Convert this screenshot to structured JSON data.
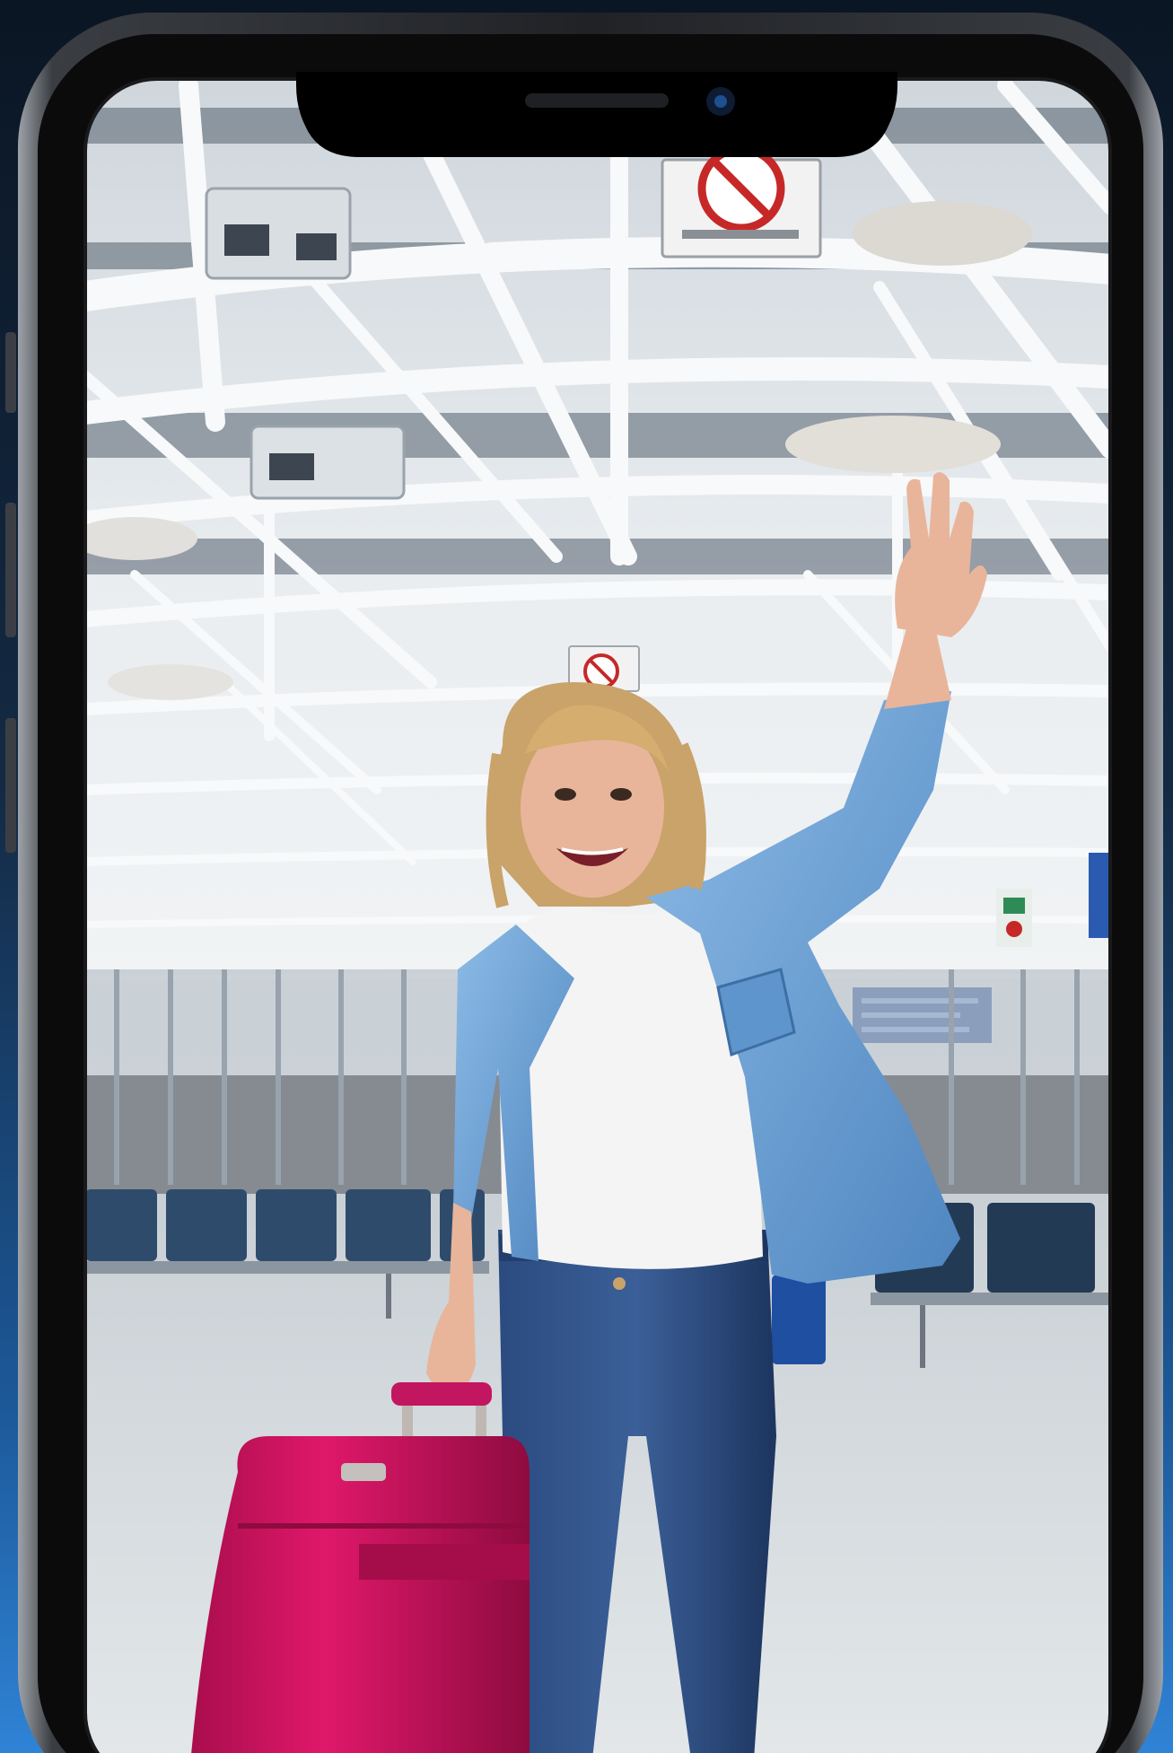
{
  "colors": {
    "background_top": "#0d1a2a",
    "background_bottom": "#2e7fd0",
    "phone_frame": "#2b2d31",
    "phone_frame_highlight": "#b8bcc2",
    "notch": "#000000",
    "ceiling": "#e8ecef",
    "truss": "#f4f6f7",
    "floor": "#d8dde0",
    "seats": "#2f4b6b",
    "shirt_denim": "#6fa3d6",
    "tshirt": "#f4f4f4",
    "jeans": "#233e6e",
    "hair": "#c9a36a",
    "skin": "#e8b59a",
    "suitcase": "#d0135e",
    "sign_red": "#c62828",
    "info_board": "#1f4fa0"
  },
  "icons": [
    "no-smoking-sign-icon",
    "no-smoking-sign-small-icon",
    "front-camera-icon",
    "speaker-grille-icon"
  ]
}
